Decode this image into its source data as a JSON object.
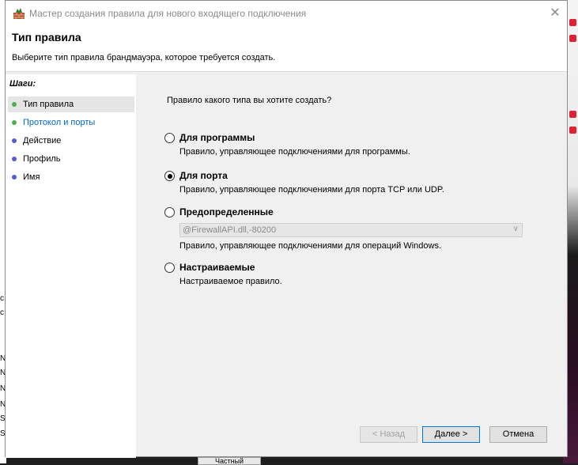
{
  "window": {
    "title": "Мастер создания правила для нового входящего подключения",
    "close_glyph": "✕"
  },
  "header": {
    "title": "Тип правила",
    "description": "Выберите тип правила брандмауэра, которое требуется создать."
  },
  "steps": {
    "title": "Шаги:",
    "items": [
      {
        "label": "Тип правила",
        "dot_color": "#4caf50"
      },
      {
        "label": "Протокол и порты",
        "dot_color": "#4caf50"
      },
      {
        "label": "Действие",
        "dot_color": "#5a5ad6"
      },
      {
        "label": "Профиль",
        "dot_color": "#5a5ad6"
      },
      {
        "label": "Имя",
        "dot_color": "#5a5ad6"
      }
    ]
  },
  "main": {
    "question": "Правило какого типа вы хотите создать?",
    "options": [
      {
        "title": "Для программы",
        "description": "Правило, управляющее подключениями для программы.",
        "checked": false
      },
      {
        "title": "Для порта",
        "description": "Правило, управляющее подключениями для порта TCP или UDP.",
        "checked": true
      },
      {
        "title": "Предопределенные",
        "description": "Правило, управляющее подключениями для операций Windows.",
        "checked": false
      },
      {
        "title": "Настраиваемые",
        "description": "Настраиваемое правило.",
        "checked": false
      }
    ],
    "predefined_select": {
      "value": "@FirewallAPI.dll,-80200",
      "enabled": false
    }
  },
  "buttons": {
    "back": "< Назад",
    "next": "Далее >",
    "cancel": "Отмена"
  },
  "background": {
    "left_fragments": [
      "c",
      "c",
      "N",
      "N",
      "N",
      "N",
      "S",
      "S"
    ],
    "bottom_fragment": "Частный"
  }
}
